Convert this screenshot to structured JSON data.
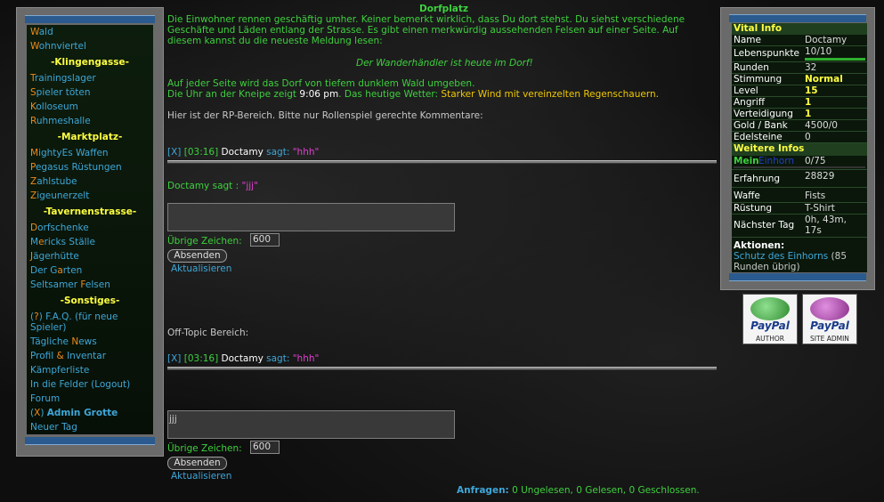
{
  "nav": {
    "items": [
      {
        "first": "W",
        "rest": "ald"
      },
      {
        "first": "W",
        "rest": "ohnviertel"
      }
    ],
    "head1": "-Klingengasse-",
    "klingen": [
      {
        "first": "T",
        "rest": "rainingslager"
      },
      {
        "first": "S",
        "rest": "pieler töten"
      },
      {
        "first": "K",
        "rest": "olloseum"
      },
      {
        "first": "R",
        "rest": "uhmeshalle"
      }
    ],
    "head2": "-Marktplatz-",
    "markt": [
      {
        "pre": "",
        "first": "M",
        "rest": "ightyEs Waffen"
      },
      {
        "pre": "",
        "first": "P",
        "rest": "egasus Rüstungen"
      },
      {
        "pre": "",
        "first": "Z",
        "rest": "ahlstube"
      },
      {
        "pre": "",
        "first": "Z",
        "rest": "igeunerzelt"
      }
    ],
    "head3": "-Tavernenstrasse-",
    "taverne": [
      {
        "pre": "",
        "first": "D",
        "rest": "orfschenke"
      },
      {
        "pre": "M",
        "first": "e",
        "rest": "ricks Ställe"
      },
      {
        "pre": "",
        "first": "J",
        "rest": "ägerhütte"
      },
      {
        "pre": "Der G",
        "first": "a",
        "rest": "rten"
      },
      {
        "pre": "Seltsamer ",
        "first": "F",
        "rest": "elsen"
      }
    ],
    "head4": "-Sonstiges-",
    "sonst": {
      "faq_pre": "(",
      "faq_key": "?",
      "faq_rest": ") F.A.Q. (für neue",
      "faq_line2": "Spieler)",
      "news_pre": "Tägliche ",
      "news_key": "N",
      "news_rest": "ews",
      "inv_pre": "Profil ",
      "inv_key": "&",
      "inv_rest": " Inventar",
      "kampf": "Kämpferliste",
      "logout": "In die Felder (Logout)",
      "forum": "Forum",
      "admin_pre": "(",
      "admin_key": "X",
      "admin_mid": ") ",
      "admin_label": "Admin Grotte",
      "newday": "Neuer Tag"
    }
  },
  "main": {
    "title": "Dorfplatz",
    "intro_l1": "Die Einwohner rennen geschäftig umher. Keiner bemerkt wirklich, dass Du dort stehst. Du siehst verschiedene",
    "intro_l2": "Geschäfte und Läden entlang der Strasse. Es gibt einen merkwürdig aussehenden Felsen auf einer Seite. Auf",
    "intro_l3": "diesem kannst du die neueste Meldung lesen:",
    "news": "Der Wanderhändler ist heute im Dorf!",
    "forest": "Auf jeder Seite wird das Dorf von tiefem dunklem Wald umgeben.",
    "clock_pre": "Die Uhr an der Kneipe zeigt ",
    "clock_time": "9:06 pm",
    "clock_mid": ". Das heutige Wetter: ",
    "weather": "Starker Wind mit vereinzelten Regenschauern.",
    "rp_note": "Hier ist der RP-Bereich. Bitte nur Rollenspiel gerechte Kommentare:",
    "rp": {
      "del": "[X]",
      "time": "[03:16]",
      "name": "Doctamy",
      "says": " sagt: ",
      "msg": "\"hhh\"",
      "preview_name": "Doctamy sagt : ",
      "preview_msg": "\"jjj\"",
      "textarea": "",
      "remain_label": "Übrige Zeichen:",
      "remain": "600",
      "submit": "Absenden",
      "refresh": "Aktualisieren"
    },
    "ot_label": "Off-Topic Bereich:",
    "ot": {
      "del": "[X]",
      "time": "[03:16]",
      "name": "Doctamy",
      "says": " sagt: ",
      "msg": "\"hhh\"",
      "textarea": "jjj",
      "remain_label": "Übrige Zeichen:",
      "remain": "600",
      "submit": "Absenden",
      "refresh": "Aktualisieren"
    },
    "footer_label": "Anfragen:",
    "footer_text": " 0 Ungelesen, 0 Gelesen, 0 Geschlossen."
  },
  "stats": {
    "vital_title": "Vital Info",
    "name_l": "Name",
    "name_v": "Doctamy",
    "hp_l": "Lebenspunkte",
    "hp_v": "10/10",
    "hp_fraction": 1.0,
    "rounds_l": "Runden",
    "rounds_v": "32",
    "mood_l": "Stimmung",
    "mood_v": "Normal",
    "level_l": "Level",
    "level_v": "15",
    "atk_l": "Angriff",
    "atk_v": "1",
    "def_l": "Verteidigung",
    "def_v": "1",
    "gold_l": "Gold / Bank",
    "gold_v": "4500/0",
    "gems_l": "Edelsteine",
    "gems_v": "0",
    "more_title": "Weitere Infos",
    "unicorn_mein": "Mein ",
    "unicorn_name": "Einhorn",
    "unicorn_v": "0/75",
    "xp_l": "Erfahrung",
    "xp_v": "28829",
    "weapon_l": "Waffe",
    "weapon_v": "Fists",
    "armor_l": "Rüstung",
    "armor_v": "T-Shirt",
    "nextday_l": "Nächster Tag",
    "nextday_v1": "0h, 43m,",
    "nextday_v2": "17s",
    "actions_l": "Aktionen:",
    "action_v1": "Schutz des Einhorns",
    "action_v2": " (85",
    "action_v3": "Runden übrig)"
  },
  "paypal": {
    "logo": "PayPal",
    "author": "AUTHOR",
    "admin": "SITE ADMIN",
    "author_color": "#2e8a2e",
    "admin_color": "#8a2e8a"
  }
}
